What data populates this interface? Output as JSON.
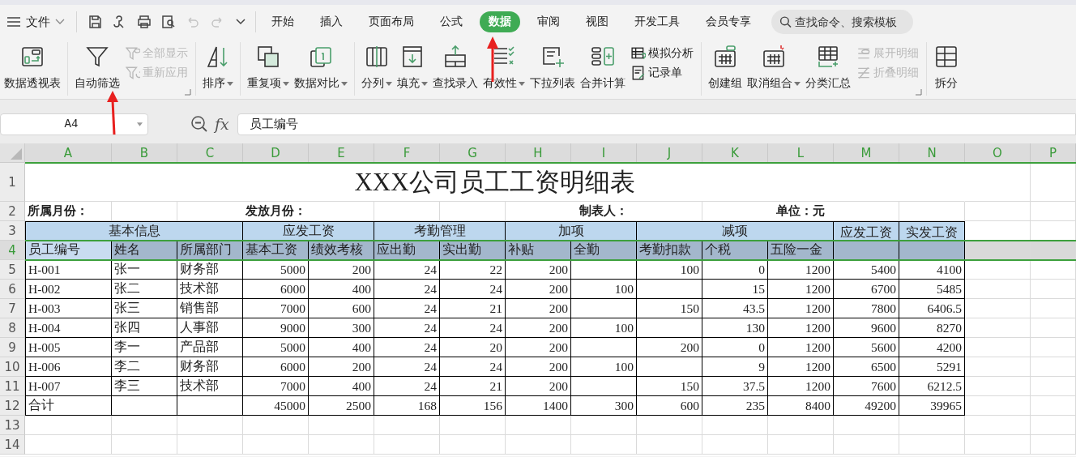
{
  "menu": {
    "file": "文件"
  },
  "quick_access": [
    {
      "disabled": false
    },
    {
      "disabled": false
    },
    {
      "disabled": false
    },
    {
      "disabled": false
    },
    {
      "disabled": true
    },
    {
      "disabled": true
    }
  ],
  "tabs": [
    {
      "label": "开始",
      "selected": false
    },
    {
      "label": "插入",
      "selected": false
    },
    {
      "label": "页面布局",
      "selected": false
    },
    {
      "label": "公式",
      "selected": false
    },
    {
      "label": "数据",
      "selected": true
    },
    {
      "label": "审阅",
      "selected": false
    },
    {
      "label": "视图",
      "selected": false
    },
    {
      "label": "开发工具",
      "selected": false
    },
    {
      "label": "会员专享",
      "selected": false
    }
  ],
  "search": {
    "placeholder": "查找命令、搜索模板"
  },
  "ribbon": {
    "groups": [
      {
        "items": [
          {
            "kind": "large",
            "label": "数据透视表",
            "dropdown": false
          }
        ]
      },
      {
        "items": [
          {
            "kind": "large",
            "label": "自动筛选",
            "dropdown": false
          },
          {
            "kind": "stack",
            "items": [
              {
                "label": "全部显示",
                "disabled": true
              },
              {
                "label": "重新应用",
                "disabled": true
              }
            ]
          }
        ]
      },
      {
        "items": [
          {
            "kind": "large",
            "label": "排序",
            "dropdown": true
          }
        ]
      },
      {
        "items": [
          {
            "kind": "large",
            "label": "重复项",
            "dropdown": true
          },
          {
            "kind": "large",
            "label": "数据对比",
            "dropdown": true
          }
        ]
      },
      {
        "items": [
          {
            "kind": "large",
            "label": "分列",
            "dropdown": true
          },
          {
            "kind": "large",
            "label": "填充",
            "dropdown": true
          },
          {
            "kind": "large",
            "label": "查找录入",
            "dropdown": false
          },
          {
            "kind": "large",
            "label": "有效性",
            "dropdown": true
          },
          {
            "kind": "large",
            "label": "下拉列表",
            "dropdown": false
          },
          {
            "kind": "large",
            "label": "合并计算",
            "dropdown": false
          },
          {
            "kind": "stack",
            "items": [
              {
                "label": "模拟分析",
                "disabled": false
              },
              {
                "label": "记录单",
                "disabled": false
              }
            ]
          }
        ]
      },
      {
        "items": [
          {
            "kind": "large",
            "label": "创建组",
            "dropdown": false
          },
          {
            "kind": "large",
            "label": "取消组合",
            "dropdown": true
          },
          {
            "kind": "large",
            "label": "分类汇总",
            "dropdown": false
          },
          {
            "kind": "stack",
            "items": [
              {
                "label": "展开明细",
                "disabled": true
              },
              {
                "label": "折叠明细",
                "disabled": true
              }
            ]
          }
        ]
      },
      {
        "items": [
          {
            "kind": "large",
            "label": "拆分",
            "dropdown": false
          }
        ]
      }
    ]
  },
  "formula_bar": {
    "name_box": "A4",
    "fx": "fx",
    "formula": "员工编号"
  },
  "sheet": {
    "columns": [
      "A",
      "B",
      "C",
      "D",
      "E",
      "F",
      "G",
      "H",
      "I",
      "J",
      "K",
      "L",
      "M",
      "N",
      "O",
      "P"
    ],
    "rows": [
      {
        "number": "1",
        "selected": false,
        "cells": [
          {
            "kind": "title",
            "text": "XXX公司员工工资明细表"
          },
          {
            "kind": "merged"
          },
          {
            "kind": "merged"
          },
          {
            "kind": "merged"
          },
          {
            "kind": "merged"
          },
          {
            "kind": "merged"
          },
          {
            "kind": "merged"
          },
          {
            "kind": "merged"
          },
          {
            "kind": "merged"
          },
          {
            "kind": "merged"
          },
          {
            "kind": "merged"
          },
          {
            "kind": "merged"
          },
          {
            "kind": "merged"
          },
          {
            "kind": "merged"
          }
        ]
      },
      {
        "number": "2",
        "selected": false,
        "cells": [
          {
            "kind": "label-left",
            "text": "所属月份："
          },
          {
            "kind": "empty"
          },
          {
            "kind": "label",
            "text": "发放月份："
          },
          {
            "kind": "merged"
          },
          {
            "kind": "merged"
          },
          {
            "kind": "empty"
          },
          {
            "kind": "empty"
          },
          {
            "kind": "label",
            "text": "制表人："
          },
          {
            "kind": "merged"
          },
          {
            "kind": "merged"
          },
          {
            "kind": "label",
            "text": "单位：元"
          },
          {
            "kind": "merged"
          },
          {
            "kind": "merged"
          }
        ]
      },
      {
        "number": "3",
        "selected": false,
        "cells": [
          {
            "kind": "group",
            "text": "基本信息"
          },
          {
            "kind": "merged"
          },
          {
            "kind": "merged"
          },
          {
            "kind": "group",
            "text": "应发工资"
          },
          {
            "kind": "merged"
          },
          {
            "kind": "group",
            "text": "考勤管理"
          },
          {
            "kind": "merged"
          },
          {
            "kind": "group",
            "text": "加项"
          },
          {
            "kind": "merged"
          },
          {
            "kind": "group",
            "text": "减项"
          },
          {
            "kind": "merged"
          },
          {
            "kind": "merged"
          },
          {
            "kind": "group",
            "text": "应发工资"
          },
          {
            "kind": "group",
            "text": "实发工资"
          }
        ]
      },
      {
        "number": "4",
        "selected": true,
        "cells": [
          {
            "kind": "header",
            "text": "员工编号",
            "active": true
          },
          {
            "kind": "header",
            "text": "姓名"
          },
          {
            "kind": "header",
            "text": "所属部门"
          },
          {
            "kind": "header",
            "text": "基本工资"
          },
          {
            "kind": "header",
            "text": "绩效考核"
          },
          {
            "kind": "header",
            "text": "应出勤"
          },
          {
            "kind": "header",
            "text": "实出勤"
          },
          {
            "kind": "header",
            "text": "补贴"
          },
          {
            "kind": "header",
            "text": "全勤"
          },
          {
            "kind": "header",
            "text": "考勤扣款"
          },
          {
            "kind": "header",
            "text": "个税"
          },
          {
            "kind": "header",
            "text": "五险一金"
          },
          {
            "kind": "merged-above"
          },
          {
            "kind": "merged-above"
          }
        ]
      },
      {
        "number": "5",
        "selected": false,
        "cells": [
          {
            "kind": "text",
            "text": "H-001"
          },
          {
            "kind": "text",
            "text": "张一"
          },
          {
            "kind": "text",
            "text": "财务部"
          },
          {
            "kind": "number",
            "text": "5000"
          },
          {
            "kind": "number",
            "text": "200"
          },
          {
            "kind": "number",
            "text": "24"
          },
          {
            "kind": "number",
            "text": "22"
          },
          {
            "kind": "number",
            "text": "200"
          },
          {
            "kind": "empty"
          },
          {
            "kind": "number",
            "text": "100"
          },
          {
            "kind": "number",
            "text": "0"
          },
          {
            "kind": "number",
            "text": "1200"
          },
          {
            "kind": "number",
            "text": "5400"
          },
          {
            "kind": "number",
            "text": "4100"
          }
        ]
      },
      {
        "number": "6",
        "selected": false,
        "cells": [
          {
            "kind": "text",
            "text": "H-002"
          },
          {
            "kind": "text",
            "text": "张二"
          },
          {
            "kind": "text",
            "text": "技术部"
          },
          {
            "kind": "number",
            "text": "6000"
          },
          {
            "kind": "number",
            "text": "400"
          },
          {
            "kind": "number",
            "text": "24"
          },
          {
            "kind": "number",
            "text": "24"
          },
          {
            "kind": "number",
            "text": "200"
          },
          {
            "kind": "number",
            "text": "100"
          },
          {
            "kind": "empty"
          },
          {
            "kind": "number",
            "text": "15"
          },
          {
            "kind": "number",
            "text": "1200"
          },
          {
            "kind": "number",
            "text": "6700"
          },
          {
            "kind": "number",
            "text": "5485"
          }
        ]
      },
      {
        "number": "7",
        "selected": false,
        "cells": [
          {
            "kind": "text",
            "text": "H-003"
          },
          {
            "kind": "text",
            "text": "张三"
          },
          {
            "kind": "text",
            "text": "销售部"
          },
          {
            "kind": "number",
            "text": "7000"
          },
          {
            "kind": "number",
            "text": "600"
          },
          {
            "kind": "number",
            "text": "24"
          },
          {
            "kind": "number",
            "text": "21"
          },
          {
            "kind": "number",
            "text": "200"
          },
          {
            "kind": "empty"
          },
          {
            "kind": "number",
            "text": "150"
          },
          {
            "kind": "number",
            "text": "43.5"
          },
          {
            "kind": "number",
            "text": "1200"
          },
          {
            "kind": "number",
            "text": "7800"
          },
          {
            "kind": "number",
            "text": "6406.5"
          }
        ]
      },
      {
        "number": "8",
        "selected": false,
        "cells": [
          {
            "kind": "text",
            "text": "H-004"
          },
          {
            "kind": "text",
            "text": "张四"
          },
          {
            "kind": "text",
            "text": "人事部"
          },
          {
            "kind": "number",
            "text": "9000"
          },
          {
            "kind": "number",
            "text": "300"
          },
          {
            "kind": "number",
            "text": "24"
          },
          {
            "kind": "number",
            "text": "24"
          },
          {
            "kind": "number",
            "text": "200"
          },
          {
            "kind": "number",
            "text": "100"
          },
          {
            "kind": "empty"
          },
          {
            "kind": "number",
            "text": "130"
          },
          {
            "kind": "number",
            "text": "1200"
          },
          {
            "kind": "number",
            "text": "9600"
          },
          {
            "kind": "number",
            "text": "8270"
          }
        ]
      },
      {
        "number": "9",
        "selected": false,
        "cells": [
          {
            "kind": "text",
            "text": "H-005"
          },
          {
            "kind": "text",
            "text": "李一"
          },
          {
            "kind": "text",
            "text": "产品部"
          },
          {
            "kind": "number",
            "text": "5000"
          },
          {
            "kind": "number",
            "text": "400"
          },
          {
            "kind": "number",
            "text": "24"
          },
          {
            "kind": "number",
            "text": "20"
          },
          {
            "kind": "number",
            "text": "200"
          },
          {
            "kind": "empty"
          },
          {
            "kind": "number",
            "text": "200"
          },
          {
            "kind": "number",
            "text": "0"
          },
          {
            "kind": "number",
            "text": "1200"
          },
          {
            "kind": "number",
            "text": "5600"
          },
          {
            "kind": "number",
            "text": "4200"
          }
        ]
      },
      {
        "number": "10",
        "selected": false,
        "cells": [
          {
            "kind": "text",
            "text": "H-006"
          },
          {
            "kind": "text",
            "text": "李二"
          },
          {
            "kind": "text",
            "text": "财务部"
          },
          {
            "kind": "number",
            "text": "6000"
          },
          {
            "kind": "number",
            "text": "200"
          },
          {
            "kind": "number",
            "text": "24"
          },
          {
            "kind": "number",
            "text": "24"
          },
          {
            "kind": "number",
            "text": "200"
          },
          {
            "kind": "number",
            "text": "100"
          },
          {
            "kind": "empty"
          },
          {
            "kind": "number",
            "text": "9"
          },
          {
            "kind": "number",
            "text": "1200"
          },
          {
            "kind": "number",
            "text": "6500"
          },
          {
            "kind": "number",
            "text": "5291"
          }
        ]
      },
      {
        "number": "11",
        "selected": false,
        "cells": [
          {
            "kind": "text",
            "text": "H-007"
          },
          {
            "kind": "text",
            "text": "李三"
          },
          {
            "kind": "text",
            "text": "技术部"
          },
          {
            "kind": "number",
            "text": "7000"
          },
          {
            "kind": "number",
            "text": "400"
          },
          {
            "kind": "number",
            "text": "24"
          },
          {
            "kind": "number",
            "text": "21"
          },
          {
            "kind": "number",
            "text": "200"
          },
          {
            "kind": "empty"
          },
          {
            "kind": "number",
            "text": "150"
          },
          {
            "kind": "number",
            "text": "37.5"
          },
          {
            "kind": "number",
            "text": "1200"
          },
          {
            "kind": "number",
            "text": "7600"
          },
          {
            "kind": "number",
            "text": "6212.5"
          }
        ]
      },
      {
        "number": "12",
        "selected": false,
        "cells": [
          {
            "kind": "text",
            "text": "合计"
          },
          {
            "kind": "empty"
          },
          {
            "kind": "empty"
          },
          {
            "kind": "number",
            "text": "45000"
          },
          {
            "kind": "number",
            "text": "2500"
          },
          {
            "kind": "number",
            "text": "168"
          },
          {
            "kind": "number",
            "text": "156"
          },
          {
            "kind": "number",
            "text": "1400"
          },
          {
            "kind": "number",
            "text": "300"
          },
          {
            "kind": "number",
            "text": "600"
          },
          {
            "kind": "number",
            "text": "235"
          },
          {
            "kind": "number",
            "text": "8400"
          },
          {
            "kind": "number",
            "text": "49200"
          },
          {
            "kind": "number",
            "text": "39965"
          }
        ]
      },
      {
        "number": "13",
        "selected": false
      },
      {
        "number": "14",
        "selected": false
      }
    ]
  }
}
